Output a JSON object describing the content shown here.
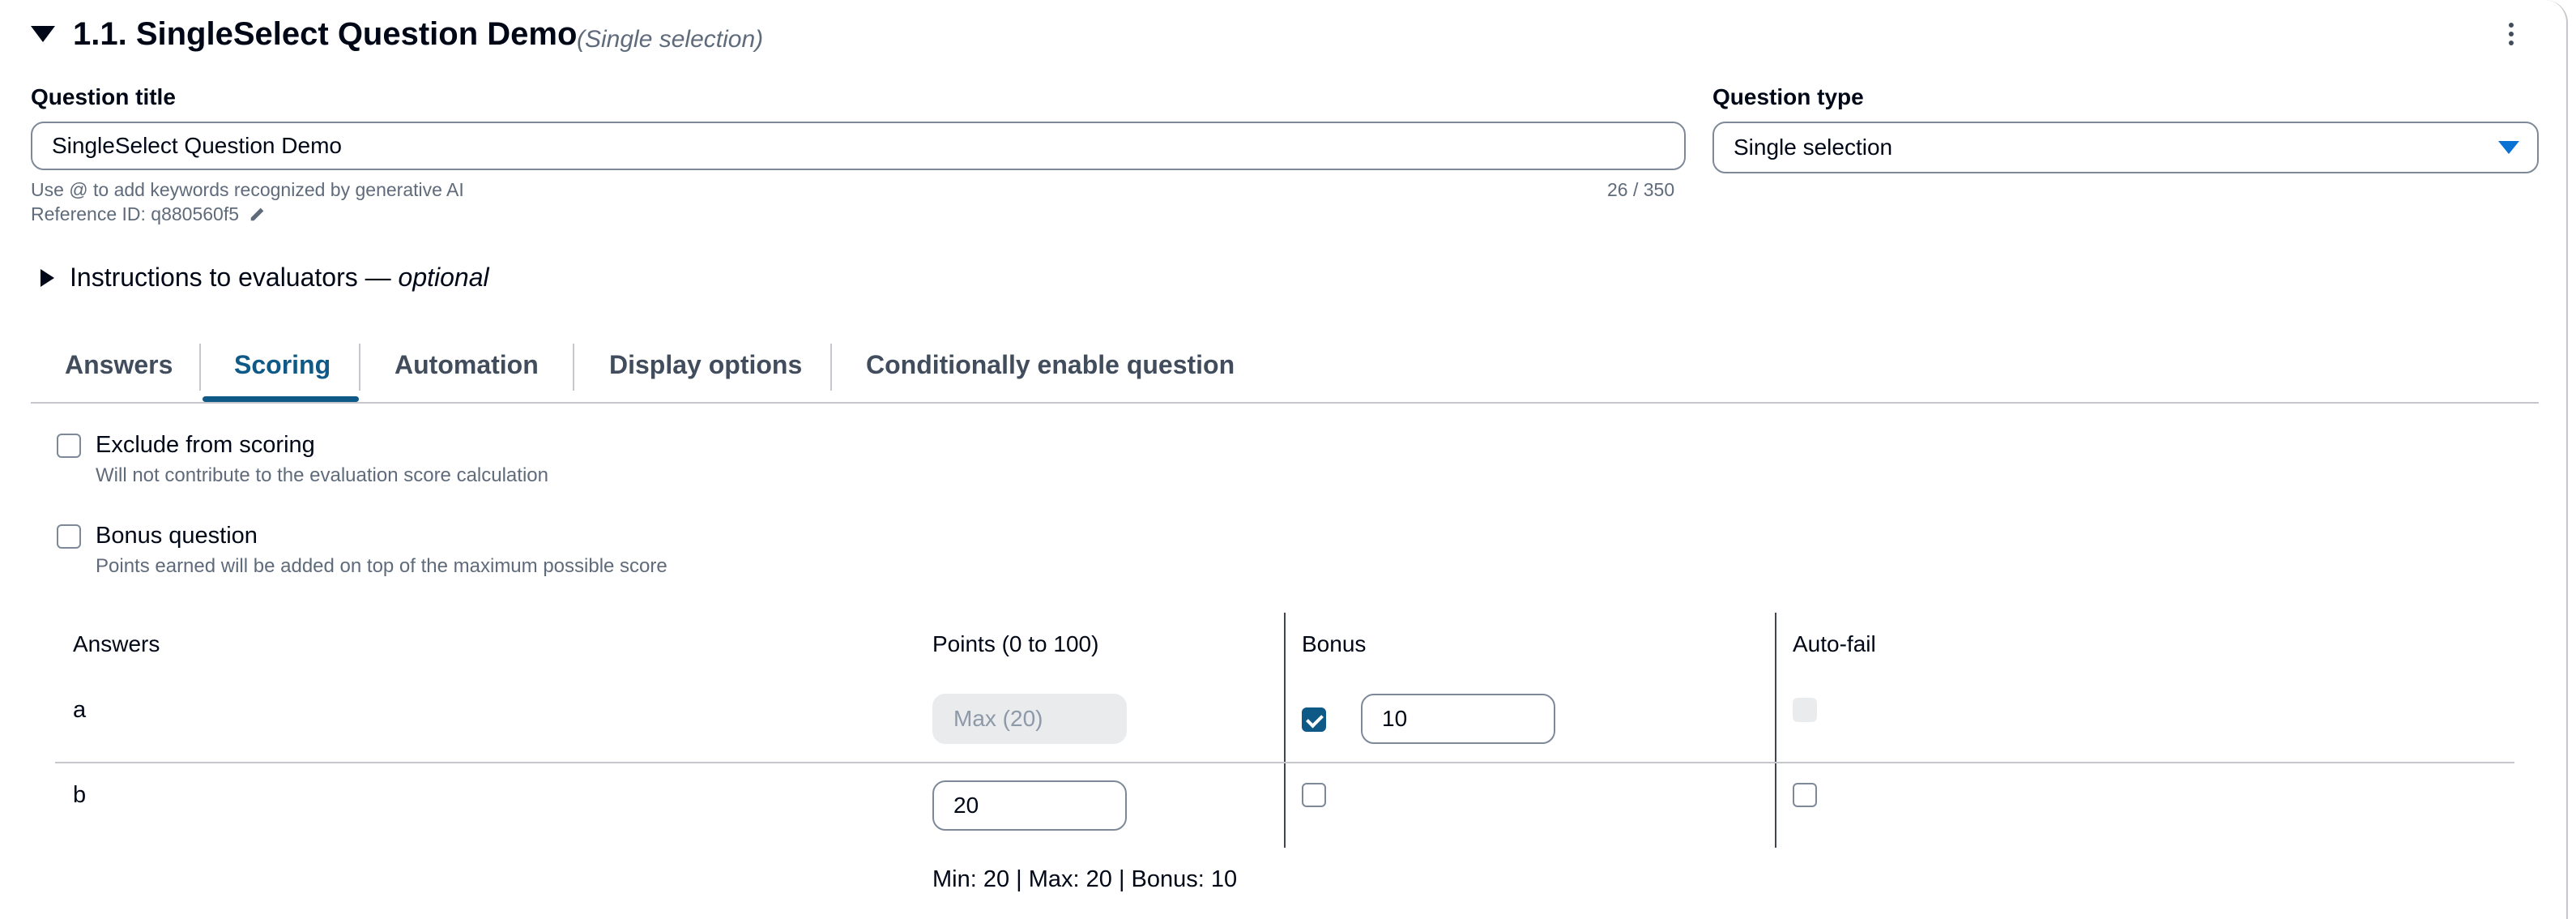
{
  "header": {
    "title": "1.1. SingleSelect Question Demo",
    "subtitle": "(Single selection)"
  },
  "question_title": {
    "label": "Question title",
    "value": "SingleSelect Question Demo",
    "hint": "Use @ to add keywords recognized by generative AI",
    "counter": "26 / 350",
    "reference_id": "Reference ID: q880560f5"
  },
  "question_type": {
    "label": "Question type",
    "value": "Single selection"
  },
  "instructions": {
    "label": "Instructions to evaluators — ",
    "optional": "optional"
  },
  "tabs": [
    {
      "label": "Answers",
      "active": false
    },
    {
      "label": "Scoring",
      "active": true
    },
    {
      "label": "Automation",
      "active": false
    },
    {
      "label": "Display options",
      "active": false
    },
    {
      "label": "Conditionally enable question",
      "active": false
    }
  ],
  "scoring": {
    "exclude": {
      "label": "Exclude from scoring",
      "description": "Will not contribute to the evaluation score calculation",
      "checked": false
    },
    "bonus": {
      "label": "Bonus question",
      "description": "Points earned will be added on top of the maximum possible score",
      "checked": false
    }
  },
  "table": {
    "headers": {
      "answers": "Answers",
      "points": "Points (0 to 100)",
      "bonus": "Bonus",
      "autofail": "Auto-fail"
    },
    "rows": [
      {
        "answer": "a",
        "points_placeholder": "Max (20)",
        "points_value": "",
        "points_disabled": true,
        "bonus_checked": true,
        "bonus_value": "10",
        "autofail_checked": false,
        "autofail_disabled": true
      },
      {
        "answer": "b",
        "points_placeholder": "",
        "points_value": "20",
        "points_disabled": false,
        "bonus_checked": false,
        "bonus_value": "",
        "autofail_checked": false,
        "autofail_disabled": false
      }
    ],
    "summary": "Min: 20 | Max: 20 | Bonus: 10"
  },
  "colors": {
    "accent": "#0f5986",
    "link_blue": "#0972d3",
    "text": "#000716",
    "muted": "#5f6b7a",
    "border": "#7d8998"
  },
  "icons": [
    "caret-down-icon",
    "kebab-menu-icon",
    "pencil-icon",
    "caret-right-icon",
    "dropdown-arrow-icon",
    "checkmark-icon"
  ]
}
